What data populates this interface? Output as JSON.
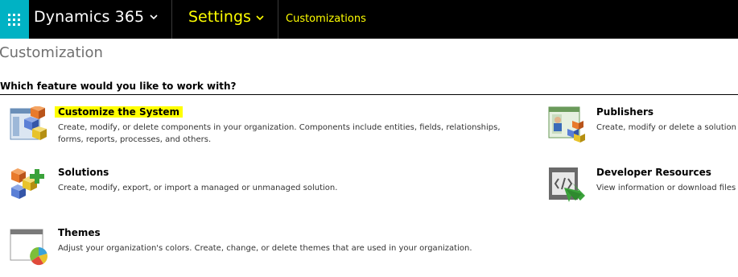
{
  "topbar": {
    "app_name": "Dynamics 365",
    "area": "Settings",
    "breadcrumb": "Customizations",
    "colors": {
      "bar": "#000000",
      "waffle": "#00b2c4",
      "area_text": "#ffff00"
    }
  },
  "page": {
    "title": "Customization",
    "question": "Which feature would you like to work with?"
  },
  "features": {
    "customize": {
      "title": "Customize the System",
      "description": "Create, modify, or delete components in your organization. Components include entities, fields, relationships, forms, reports, processes, and others.",
      "icon": "customize-system-icon"
    },
    "solutions": {
      "title": "Solutions",
      "description": "Create, modify, export, or import a managed or unmanaged solution.",
      "icon": "solutions-icon"
    },
    "themes": {
      "title": "Themes",
      "description": "Adjust your organization's colors. Create, change, or delete themes that are used in your organization.",
      "icon": "themes-icon"
    },
    "publishers": {
      "title": "Publishers",
      "description": "Create, modify or delete a solution p",
      "icon": "publishers-icon"
    },
    "devres": {
      "title": "Developer Resources",
      "description": "View information or download files t",
      "icon": "developer-resources-icon"
    }
  }
}
